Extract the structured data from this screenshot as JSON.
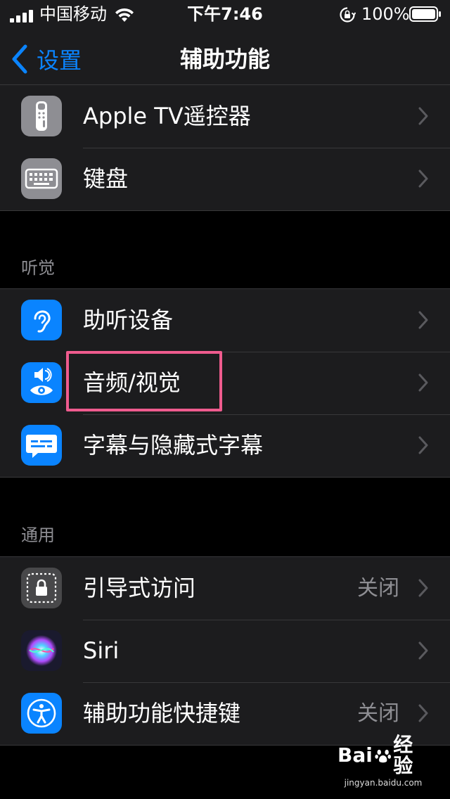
{
  "status_bar": {
    "carrier": "中国移动",
    "time": "下午7:46",
    "battery": "100%"
  },
  "nav": {
    "back_label": "设置",
    "title": "辅助功能"
  },
  "groups": {
    "physical": {
      "rows": [
        {
          "label": "Apple TV遥控器"
        },
        {
          "label": "键盘"
        }
      ]
    },
    "hearing": {
      "header": "听觉",
      "rows": [
        {
          "label": "助听设备"
        },
        {
          "label": "音频/视觉"
        },
        {
          "label": "字幕与隐藏式字幕"
        }
      ]
    },
    "general": {
      "header": "通用",
      "rows": [
        {
          "label": "引导式访问",
          "value": "关闭"
        },
        {
          "label": "Siri"
        },
        {
          "label": "辅助功能快捷键",
          "value": "关闭"
        }
      ]
    }
  },
  "watermark": {
    "logo_left": "Bai",
    "logo_right": "经验",
    "url": "jingyan.baidu.com"
  },
  "colors": {
    "accent": "#0a84ff",
    "highlight": "#ef5b8e",
    "cell_bg": "#1c1c1e"
  }
}
